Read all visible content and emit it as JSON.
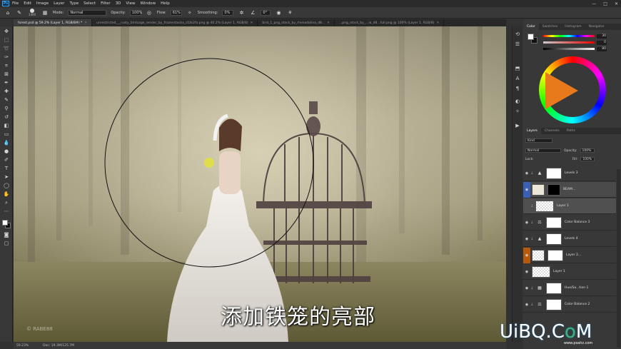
{
  "app": {
    "logo": "Ps"
  },
  "menu": [
    "File",
    "Edit",
    "Image",
    "Layer",
    "Type",
    "Select",
    "Filter",
    "3D",
    "View",
    "Window",
    "Help"
  ],
  "window_controls": [
    "—",
    "□",
    "✕"
  ],
  "options": {
    "brush_size": "1400",
    "mode_label": "Mode:",
    "mode_value": "Normal",
    "opacity_label": "Opacity:",
    "opacity_value": "100%",
    "flow_label": "Flow:",
    "flow_value": "61%",
    "smoothing_label": "Smoothing:",
    "smoothing_value": "0%",
    "angle_value": "0°"
  },
  "tabs": [
    {
      "label": "forest.psd @ 59.2% (Layer 1, RGB/8#) *",
      "active": true
    },
    {
      "label": "unrestricted___rusty_birdcage_render_by_frozenstocks_d1lb2fa.png @ 40.2% (Layer 1, RGB/8)",
      "active": false
    },
    {
      "label": "bird_1_png_stock_by_rhenadolina_d8...",
      "active": false
    },
    {
      "label": "...png_stock_by_...ia_d8...full.png @ 100% (Layer 1, RGB/8)",
      "active": false
    }
  ],
  "status": {
    "zoom": "59.23%",
    "doc": "Doc: 19.3M/125.7M"
  },
  "subtitle": "添加铁笼的亮部",
  "watermark_left": "© RABE88",
  "watermark_right": {
    "main": "UiBQ.C",
    "o": "o",
    "m": "M",
    "url": "www.psahz.com"
  },
  "color_panel": {
    "tabs": [
      "Color",
      "Swatches",
      "Histogram",
      "Navigator"
    ],
    "values": [
      "30",
      "0",
      "80"
    ]
  },
  "layers_panel": {
    "tabs": [
      "Layers",
      "Channels",
      "Paths"
    ],
    "filter": "Kind",
    "blend": "Normal",
    "opacity_label": "Opacity:",
    "opacity": "100%",
    "lock_label": "Lock:",
    "fill_label": "Fill:",
    "fill": "100%",
    "layers": [
      {
        "name": "Levels 3",
        "type": "adjustment"
      },
      {
        "name": "BEAM...",
        "type": "group-selected"
      },
      {
        "name": "Layer 1",
        "type": "pixel-selected"
      },
      {
        "name": "Color Balance 3",
        "type": "adjustment"
      },
      {
        "name": "Levels 4",
        "type": "adjustment"
      },
      {
        "name": "Layer 2...",
        "type": "masked"
      },
      {
        "name": "Layer 1",
        "type": "pixel"
      },
      {
        "name": "Hue/Sa...tion 1",
        "type": "adjustment"
      },
      {
        "name": "Color Balance 2",
        "type": "adjustment"
      }
    ]
  },
  "colors": {
    "accent": "#31a8ff",
    "orange_swatch": "#b85a0c",
    "selected_row": "#4a4a4a"
  }
}
